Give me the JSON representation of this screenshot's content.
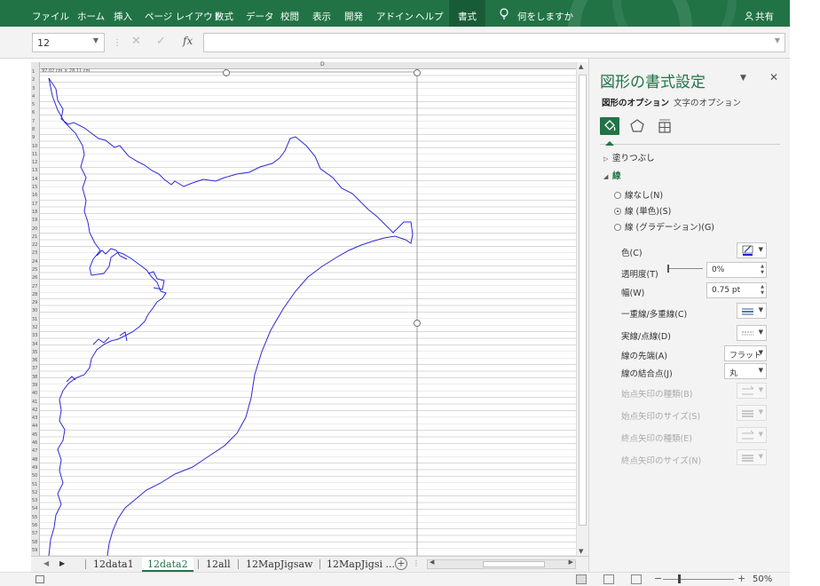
{
  "ribbon": {
    "tabs": [
      "ファイル",
      "ホーム",
      "挿入",
      "ページ レイアウト",
      "数式",
      "データ",
      "校閲",
      "表示",
      "開発",
      "アドイン",
      "ヘルプ"
    ],
    "active_tab": "書式",
    "tell_me": "何をしますか",
    "share": "共有",
    "color": "#217346"
  },
  "formula_bar": {
    "name_box": "12",
    "fx": "fx",
    "formula": ""
  },
  "sheet": {
    "column_header": "D",
    "size_label": "97.02 cm × 28.11 cm",
    "row_numbers": [
      "1",
      "2",
      "3",
      "4",
      "5",
      "6",
      "7",
      "8",
      "9",
      "10",
      "11",
      "12",
      "13",
      "14",
      "15",
      "16",
      "17",
      "18",
      "19",
      "20",
      "21",
      "22",
      "23",
      "24",
      "25",
      "26",
      "27",
      "28",
      "29",
      "30",
      "31",
      "32",
      "33",
      "34",
      "35",
      "36",
      "37",
      "38",
      "39",
      "40",
      "41",
      "42",
      "43",
      "44",
      "45",
      "46",
      "47",
      "48",
      "49",
      "50",
      "51",
      "52",
      "53",
      "54",
      "55",
      "56",
      "57",
      "58",
      "59"
    ],
    "shape_color": "#2b2bd6"
  },
  "sheet_tabs": {
    "tabs": [
      "12data1",
      "12data2",
      "12all",
      "12MapJigsaw",
      "12MapJigsi ..."
    ],
    "active": "12data2"
  },
  "status_bar": {
    "zoom": "50%"
  },
  "pane": {
    "title": "図形の書式設定",
    "tab_shape": "図形のオプション",
    "tab_text": "文字のオプション",
    "section_fill": "塗りつぶし",
    "section_line": "線",
    "radio_none": "線なし(N)",
    "radio_solid": "線 (単色)(S)",
    "radio_gradient": "線 (グラデーション)(G)",
    "color_label": "色(C)",
    "transparency_label": "透明度(T)",
    "transparency_value": "0%",
    "width_label": "幅(W)",
    "width_value": "0.75 pt",
    "compound_label": "一重線/多重線(C)",
    "dash_label": "実線/点線(D)",
    "cap_label": "線の先端(A)",
    "cap_value": "フラット",
    "join_label": "線の結合点(J)",
    "join_value": "丸",
    "begin_arrow_type": "始点矢印の種類(B)",
    "begin_arrow_size": "始点矢印のサイズ(S)",
    "end_arrow_type": "終点矢印の種類(E)",
    "end_arrow_size": "終点矢印のサイズ(N)",
    "accent_color": "#217346"
  }
}
